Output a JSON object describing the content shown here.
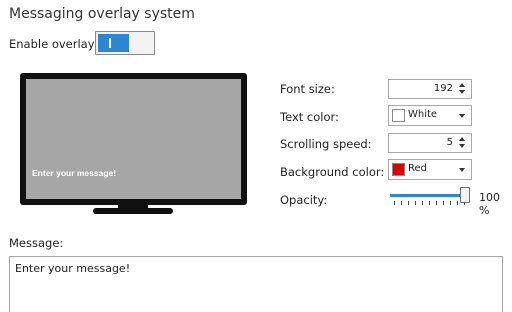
{
  "title": "Messaging overlay system",
  "enable_overlay": {
    "label": "Enable overlay",
    "on": true
  },
  "preview": {
    "text": "Enter your message!",
    "screen_color": "#a6a6a6",
    "text_color": "#ffffff"
  },
  "settings": {
    "font_size": {
      "label": "Font size:",
      "value": "192"
    },
    "text_color": {
      "label": "Text color:",
      "value": "White",
      "swatch": "#ffffff"
    },
    "scrolling_speed": {
      "label": "Scrolling speed:",
      "value": "5"
    },
    "background_color": {
      "label": "Background color:",
      "value": "Red",
      "swatch": "#e00000"
    },
    "opacity": {
      "label": "Opacity:",
      "value": 100,
      "value_text": "100 %"
    }
  },
  "message": {
    "label": "Message:",
    "value": "Enter your message!"
  },
  "colors": {
    "accent": "#2b87d3"
  }
}
